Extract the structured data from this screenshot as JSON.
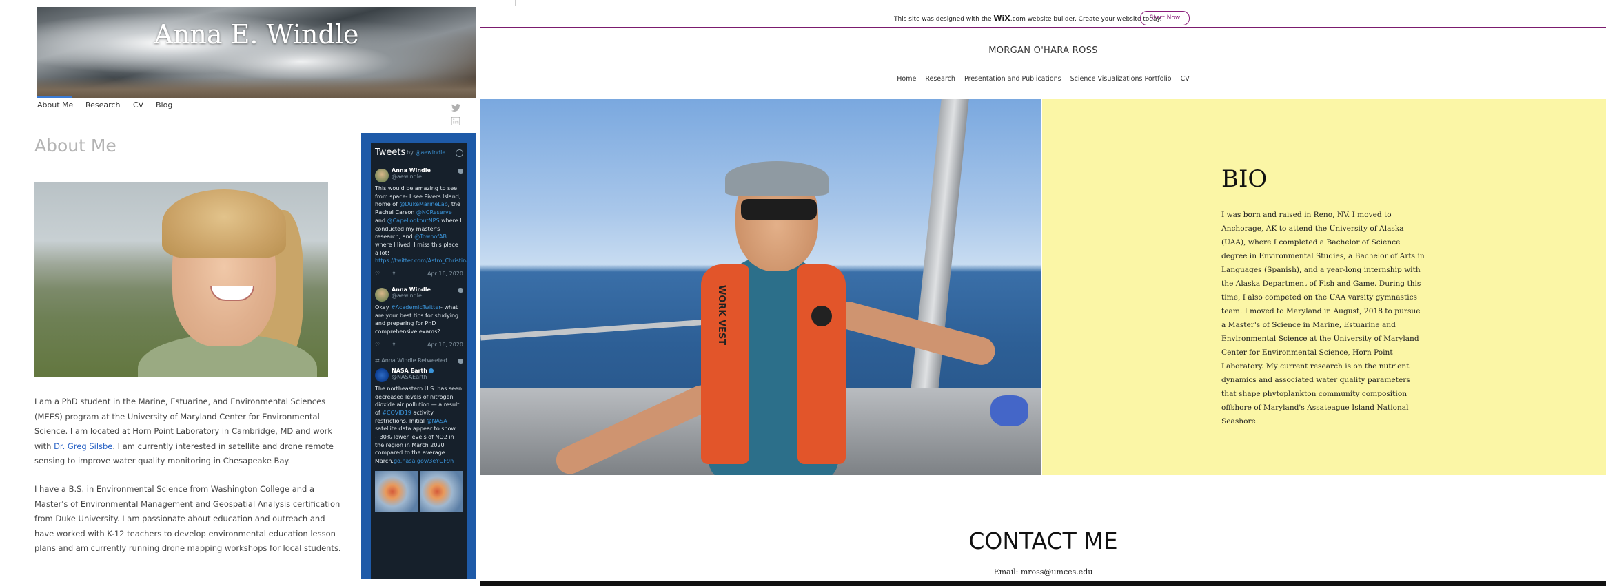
{
  "left": {
    "site_title": "Anna E. Windle",
    "nav": [
      "About Me",
      "Research",
      "CV",
      "Blog"
    ],
    "social": [
      "twitter-icon",
      "linkedin-icon"
    ],
    "heading": "About Me",
    "para1_a": "I am a PhD student in the Marine, Estuarine, and Environmental Sciences (MEES) program at the University of Maryland Center for Environmental Science. I am located at Horn Point Laboratory in Cambridge, MD and work with ",
    "para1_link": "Dr. Greg Silsbe",
    "para1_b": ". I am currently interested in satellite and drone remote sensing to improve water quality monitoring in Chesapeake Bay.",
    "para2": "I have a B.S. in Environmental Science from Washington College and a Master's of Environmental Management and Geospatial Analysis certification from Duke University. I am passionate about education and outreach and have worked with K-12 teachers to develop environmental education lesson plans and am currently running drone mapping workshops for local students.",
    "twitter": {
      "title": "Tweets",
      "by": "by",
      "handle": "@aewindle",
      "tweets": [
        {
          "name": "Anna Windle",
          "handle": "@aewindle",
          "text_parts": [
            {
              "t": "This would be amazing to see from space- I see Pivers Island, home of ",
              "l": false
            },
            {
              "t": "@DukeMarineLab",
              "l": true
            },
            {
              "t": ", the Rachel Carson ",
              "l": false
            },
            {
              "t": "@NCReserve",
              "l": true
            },
            {
              "t": " and ",
              "l": false
            },
            {
              "t": "@CapeLookoutNPS",
              "l": true
            },
            {
              "t": " where I conducted my master's research, and ",
              "l": false
            },
            {
              "t": "@TownofAB",
              "l": true
            },
            {
              "t": " where I lived. I miss this place a lot! ",
              "l": false
            },
            {
              "t": "https://twitter.com/Astro_Christina/status/1250906727693848576",
              "l": true
            }
          ],
          "date": "Apr 16, 2020"
        },
        {
          "name": "Anna Windle",
          "handle": "@aewindle",
          "text_parts": [
            {
              "t": "Okay ",
              "l": false
            },
            {
              "t": "#AcademicTwitter",
              "l": true
            },
            {
              "t": "- what are your best tips for studying and preparing for PhD comprehensive exams?",
              "l": false
            }
          ],
          "date": "Apr 16, 2020"
        },
        {
          "retweet_label": "Anna Windle Retweeted",
          "name": "NASA Earth",
          "handle": "@NASAEarth",
          "text_parts": [
            {
              "t": "The northeastern U.S. has seen decreased levels of nitrogen dioxide air pollution — a result of ",
              "l": false
            },
            {
              "t": "#COVID19",
              "l": true
            },
            {
              "t": " activity restrictions. Initial ",
              "l": false
            },
            {
              "t": "@NASA",
              "l": true
            },
            {
              "t": " satellite data appear to show ~30% lower levels of NO2 in the region in March 2020 compared to the average March.",
              "l": false
            },
            {
              "t": "go.nasa.gov/3eYGF9h",
              "l": true
            }
          ]
        }
      ]
    }
  },
  "right": {
    "wix_text_a": "This site was designed with the ",
    "wix_logo": "WiX",
    "wix_text_b": ".com website builder. Create your website today.",
    "wix_button": "Start Now",
    "site_name": "MORGAN O'HARA ROSS",
    "nav": [
      "Home",
      "Research",
      "Presentation and Publications",
      "Science Visualizations Portfolio",
      "CV"
    ],
    "bio_heading": "BIO",
    "bio_text": "I was born and raised in Reno, NV. I moved to Anchorage, AK to attend the University of Alaska (UAA), where I completed a Bachelor of Science degree in Environmental Studies, a Bachelor of Arts in Languages (Spanish), and a year-long internship with the Alaska Department of Fish and Game. During this time, I also competed on the UAA varsity gymnastics team. I moved to Maryland in August, 2018 to pursue a Master's of Science in Marine, Estuarine and Environmental Science at the University of Maryland Center for Environmental Science, Horn Point Laboratory. My current research is on the nutrient dynamics and associated water quality parameters that shape phytoplankton community composition offshore of Maryland's Assateague Island National Seashore.",
    "contact_heading": "CONTACT ME",
    "email": "Email: mross@umces.edu",
    "vest_text": "WORK VEST",
    "colors": {
      "bio_bg": "#fbf6a6",
      "wix_purple": "#7b1b6e",
      "tw_blue": "#1e5aa8"
    }
  }
}
